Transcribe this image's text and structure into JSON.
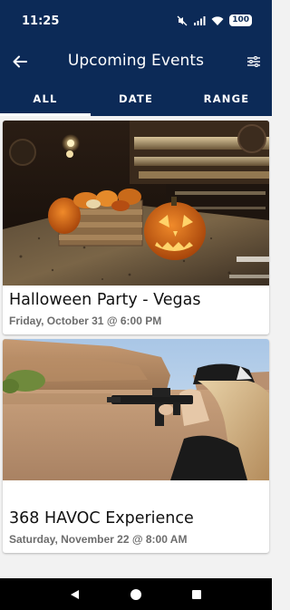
{
  "status_bar": {
    "time": "11:25",
    "battery": "100"
  },
  "app_bar": {
    "title": "Upcoming Events",
    "back_icon": "arrow-left-icon",
    "filter_icon": "sliders-icon"
  },
  "tabs": [
    {
      "label": "ALL",
      "active": true
    },
    {
      "label": "DATE",
      "active": false
    },
    {
      "label": "RANGE",
      "active": false
    }
  ],
  "events": [
    {
      "title": "Halloween Party - Vegas",
      "date": "Friday, October 31 @ 6:00 PM"
    },
    {
      "title": "368 HAVOC Experience",
      "date": "Saturday, November 22 @ 8:00 AM"
    }
  ],
  "colors": {
    "primary": "#0c2a57",
    "background": "#f2f2f2"
  }
}
